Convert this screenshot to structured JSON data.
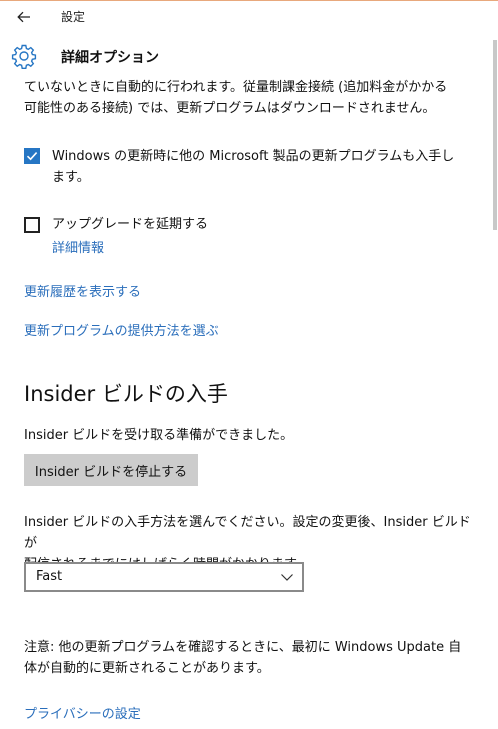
{
  "window": {
    "title": "設定"
  },
  "header": {
    "page_title": "詳細オプション"
  },
  "intro_text": {
    "line1": "ていないときに自動的に行われます。従量制課金接続 (追加料金がかかる",
    "line2": "可能性のある接続) では、更新プログラムはダウンロードされません。"
  },
  "options": {
    "ms_updates": {
      "label_line1": "Windows の更新時に他の Microsoft 製品の更新プログラムも入手し",
      "label_line2": "ます。",
      "checked": true
    },
    "defer_upgrades": {
      "label": "アップグレードを延期する",
      "checked": false,
      "details_link": "詳細情報"
    }
  },
  "links": {
    "view_history": "更新履歴を表示する",
    "choose_delivery": "更新プログラムの提供方法を選ぶ",
    "privacy": "プライバシーの設定"
  },
  "insider": {
    "heading": "Insider ビルドの入手",
    "ready_text": "Insider ビルドを受け取る準備ができました。",
    "stop_button": "Insider ビルドを停止する",
    "choose_text_line1": "Insider ビルドの入手方法を選んでください。設定の変更後、Insider ビルドが",
    "choose_text_line2": "配信されるまでにはしばらく時間がかかります。",
    "ring_selected": "Fast"
  },
  "note": {
    "line1": "注意: 他の更新プログラムを確認するときに、最初に Windows Update 自",
    "line2": "体が自動的に更新されることがあります。"
  },
  "colors": {
    "accent": "#2676c4",
    "link": "#2a6ebb",
    "button_bg": "#cccccc"
  },
  "icons": {
    "back": "back-arrow-icon",
    "settings": "gear-icon",
    "checkmark": "checkmark-icon",
    "dropdown": "chevron-down-icon"
  }
}
